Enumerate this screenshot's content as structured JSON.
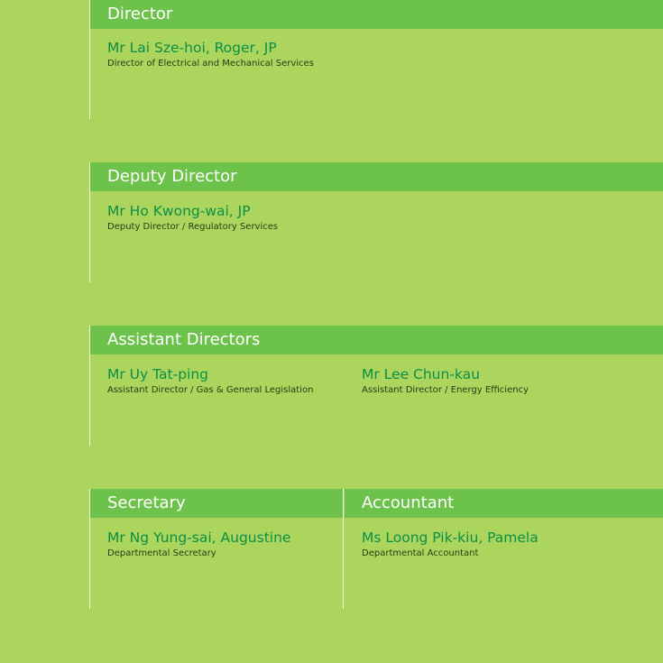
{
  "colors": {
    "background": "#acd55e",
    "header_bar": "#6dc24b",
    "header_text": "#ffffff",
    "name_text": "#0b8f46",
    "role_text": "#1f3d14",
    "divider": "#f4f9e6"
  },
  "director": {
    "title": "Director",
    "people": [
      {
        "name": "Mr Lai Sze-hoi, Roger, JP",
        "role": "Director of Electrical and Mechanical Services"
      }
    ]
  },
  "deputy_director": {
    "title": "Deputy Director",
    "people": [
      {
        "name": "Mr Ho Kwong-wai, JP",
        "role": "Deputy Director / Regulatory Services"
      }
    ]
  },
  "assistant_directors": {
    "title": "Assistant Directors",
    "people": [
      {
        "name": "Mr Uy Tat-ping",
        "role": "Assistant Director / Gas & General Legislation"
      },
      {
        "name": "Mr Lee Chun-kau",
        "role": "Assistant Director / Energy Efficiency"
      }
    ]
  },
  "secretary": {
    "title": "Secretary",
    "people": [
      {
        "name": "Mr Ng Yung-sai, Augustine",
        "role": "Departmental Secretary"
      }
    ]
  },
  "accountant": {
    "title": "Accountant",
    "people": [
      {
        "name": "Ms Loong Pik-kiu, Pamela",
        "role": "Departmental Accountant"
      }
    ]
  }
}
